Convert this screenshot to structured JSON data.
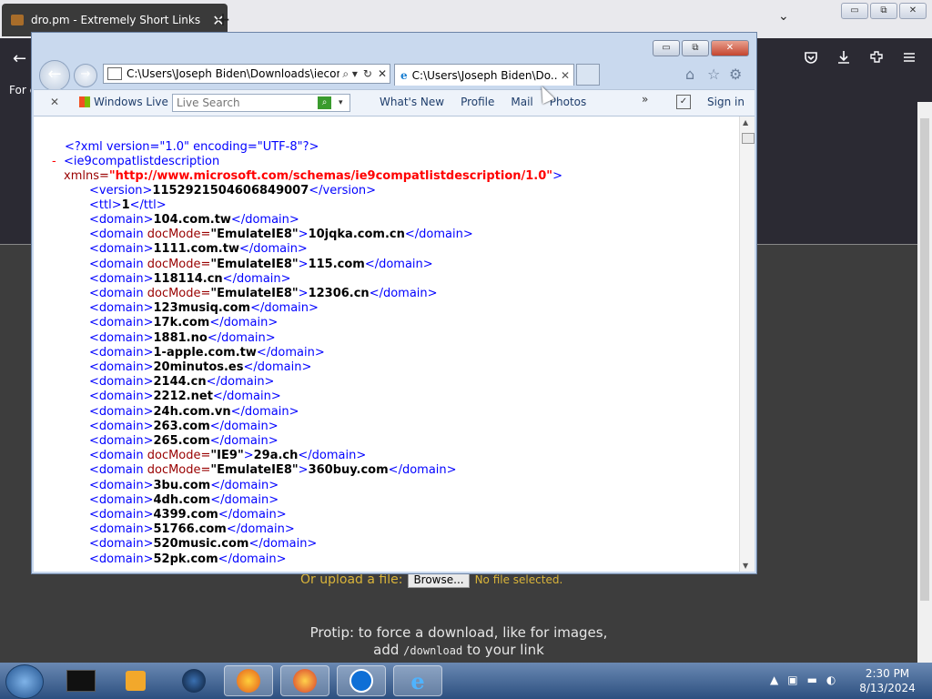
{
  "firefox": {
    "tab_title": "dro.pm - Extremely Short Links",
    "tab_close": "✕",
    "new_tab": "+",
    "list_all_tabs": "⌄",
    "back": "←",
    "partial_text": "For c",
    "window_controls": [
      "▭",
      "⧉",
      "✕"
    ],
    "toolbar_icons": [
      "pocket-icon",
      "download-icon",
      "extensions-icon",
      "menu-icon"
    ],
    "upload_label": "Or upload a file:",
    "browse_button": "Browse...",
    "no_file": "No file selected.",
    "protip_line1": "Protip: to force a download, like for images,",
    "protip_add": "add",
    "protip_code": "/download",
    "protip_end": "to your link"
  },
  "ie": {
    "window_controls": [
      "▭",
      "⧉",
      "✕"
    ],
    "address": "C:\\Users\\Joseph Biden\\Downloads\\iecom",
    "address_controls": [
      "⌕ ▾",
      "↻",
      "✕"
    ],
    "tab_title": "C:\\Users\\Joseph Biden\\Do...",
    "tab_close": "✕",
    "command_bar": {
      "close": "✕",
      "windows_live": "Windows Live",
      "search_placeholder": "Live Search",
      "search_go": "⌕",
      "search_dropdown": "▾",
      "links": [
        "What's New",
        "Profile",
        "Mail",
        "Photos"
      ],
      "more": "»",
      "checkbox": "✓",
      "sign_in": "Sign in"
    },
    "xml": {
      "declaration": "<?xml version=\"1.0\" encoding=\"UTF-8\"?>",
      "root_open": "<ie9compatlistdescription",
      "xmlns_attr": "xmlns=",
      "xmlns_value": "\"http://www.microsoft.com/schemas/ie9compatlistdescription/1.0\"",
      "version": "1152921504606849007",
      "ttl": "1",
      "domains": [
        {
          "mode": "",
          "name": "104.com.tw"
        },
        {
          "mode": "EmulateIE8",
          "name": "10jqka.com.cn"
        },
        {
          "mode": "",
          "name": "1111.com.tw"
        },
        {
          "mode": "EmulateIE8",
          "name": "115.com"
        },
        {
          "mode": "",
          "name": "118114.cn"
        },
        {
          "mode": "EmulateIE8",
          "name": "12306.cn"
        },
        {
          "mode": "",
          "name": "123musiq.com"
        },
        {
          "mode": "",
          "name": "17k.com"
        },
        {
          "mode": "",
          "name": "1881.no"
        },
        {
          "mode": "",
          "name": "1-apple.com.tw"
        },
        {
          "mode": "",
          "name": "20minutos.es"
        },
        {
          "mode": "",
          "name": "2144.cn"
        },
        {
          "mode": "",
          "name": "2212.net"
        },
        {
          "mode": "",
          "name": "24h.com.vn"
        },
        {
          "mode": "",
          "name": "263.com"
        },
        {
          "mode": "",
          "name": "265.com"
        },
        {
          "mode": "IE9",
          "name": "29a.ch"
        },
        {
          "mode": "EmulateIE8",
          "name": "360buy.com"
        },
        {
          "mode": "",
          "name": "3bu.com"
        },
        {
          "mode": "",
          "name": "4dh.com"
        },
        {
          "mode": "",
          "name": "4399.com"
        },
        {
          "mode": "",
          "name": "51766.com"
        },
        {
          "mode": "",
          "name": "520music.com"
        },
        {
          "mode": "",
          "name": "52pk.com"
        }
      ]
    }
  },
  "taskbar": {
    "items": [
      "terminal-icon",
      "media-player-icon",
      "globe-icon",
      "firefox-icon",
      "paint-icon",
      "teamviewer-icon",
      "internet-explorer-icon"
    ],
    "time": "2:30 PM",
    "date": "8/13/2024"
  }
}
